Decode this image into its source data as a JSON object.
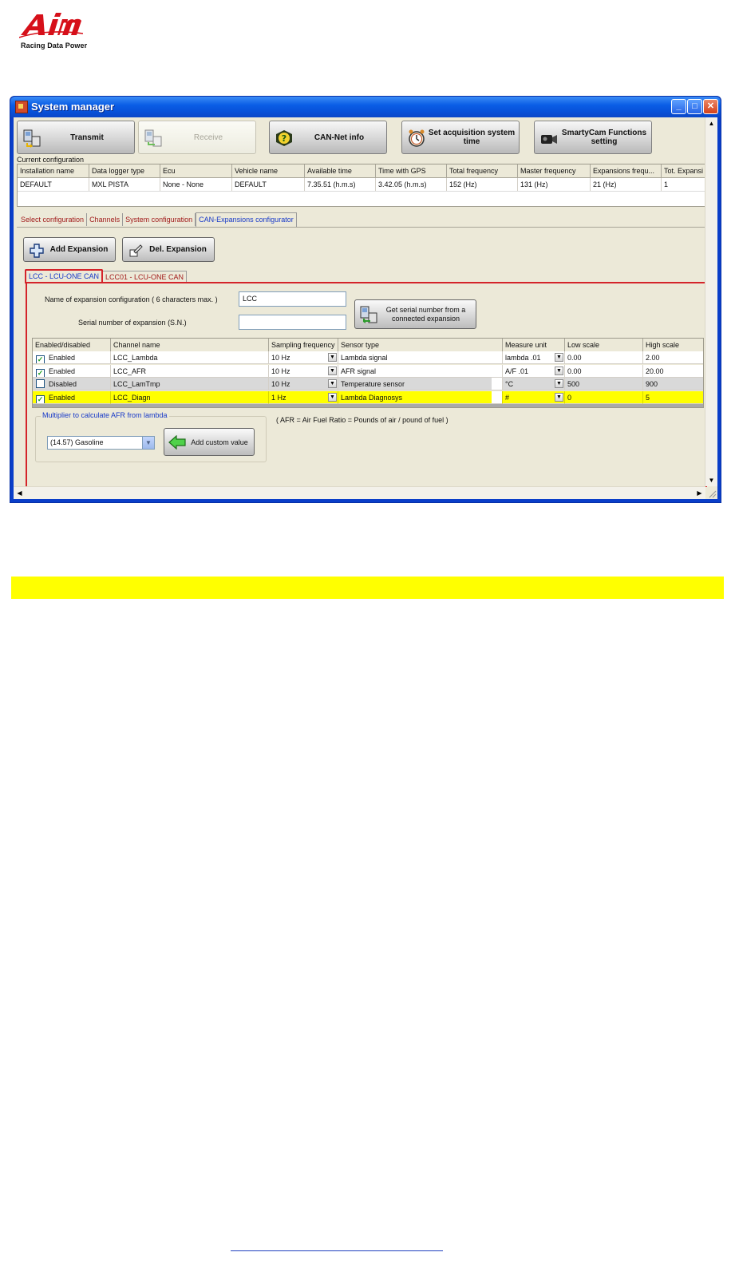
{
  "branding": {
    "logo_text": "AiM",
    "tagline": "Racing Data Power"
  },
  "window": {
    "title": "System manager",
    "minimize": "_",
    "maximize": "□",
    "close": "✕"
  },
  "toolbar": [
    {
      "label": "Transmit",
      "icon": "transmit-icon",
      "enabled": true
    },
    {
      "label": "Receive",
      "icon": "receive-icon",
      "enabled": false
    },
    {
      "label": "CAN-Net info",
      "icon": "help-icon",
      "enabled": true
    },
    {
      "label": "Set acquisition system time",
      "icon": "clock-icon",
      "enabled": true
    },
    {
      "label": "SmartyCam Functions setting",
      "icon": "camera-icon",
      "enabled": true
    }
  ],
  "current_configuration": {
    "label": "Current configuration",
    "columns": [
      "Installation name",
      "Data logger type",
      "Ecu",
      "Vehicle name",
      "Available time",
      "Time with GPS",
      "Total frequency",
      "Master frequency",
      "Expansions frequ...",
      "Tot. Expansi"
    ],
    "row": [
      "DEFAULT",
      "MXL PISTA",
      "None - None",
      "DEFAULT",
      "7.35.51 (h.m.s)",
      "3.42.05 (h.m.s)",
      "152 (Hz)",
      "131 (Hz)",
      "21 (Hz)",
      "1"
    ]
  },
  "main_tabs": [
    "Select configuration",
    "Channels",
    "System configuration",
    "CAN-Expansions configurator"
  ],
  "main_tabs_active": "CAN-Expansions configurator",
  "expansion_buttons": {
    "add": "Add Expansion",
    "del": "Del. Expansion"
  },
  "expansion_tabs": [
    "LCC - LCU-ONE CAN",
    "LCC01 - LCU-ONE CAN"
  ],
  "expansion_tabs_active": "LCC - LCU-ONE CAN",
  "form": {
    "name_label": "Name of expansion configuration ( 6 characters max. )",
    "name_value": "LCC",
    "serial_label": "Serial number of expansion (S.N.)",
    "serial_value": "",
    "serial_button": "Get serial number from a connected expansion"
  },
  "channels": {
    "columns": [
      "Enabled/disabled",
      "Channel name",
      "Sampling frequency",
      "Sensor type",
      "Measure unit",
      "Low scale",
      "High scale"
    ],
    "rows": [
      {
        "checked": true,
        "state": "Enabled",
        "name": "LCC_Lambda",
        "freq": "10 Hz",
        "sensor": "Lambda signal",
        "unit": "lambda .01",
        "low": "0.00",
        "high": "2.00",
        "style": "normal"
      },
      {
        "checked": true,
        "state": "Enabled",
        "name": "LCC_AFR",
        "freq": "10 Hz",
        "sensor": "AFR signal",
        "unit": "A/F .01",
        "low": "0.00",
        "high": "20.00",
        "style": "normal"
      },
      {
        "checked": false,
        "state": "Disabled",
        "name": "LCC_LamTmp",
        "freq": "10 Hz",
        "sensor": "Temperature sensor",
        "unit": "°C",
        "low": "500",
        "high": "900",
        "style": "disabled"
      },
      {
        "checked": true,
        "state": "Enabled",
        "name": "LCC_Diagn",
        "freq": "1 Hz",
        "sensor": "Lambda Diagnosys",
        "unit": "#",
        "low": "0",
        "high": "5",
        "style": "highlight"
      }
    ]
  },
  "multiplier": {
    "title": "Multiplier to calculate AFR from lambda",
    "selected": "(14.57) Gasoline",
    "button": "Add custom value"
  },
  "afr_note": "( AFR = Air Fuel Ratio = Pounds of air / pound of fuel )",
  "colors": {
    "highlight": "#ffff00",
    "panel_border": "#d4242a",
    "titlebar": "#0b5ee6"
  }
}
